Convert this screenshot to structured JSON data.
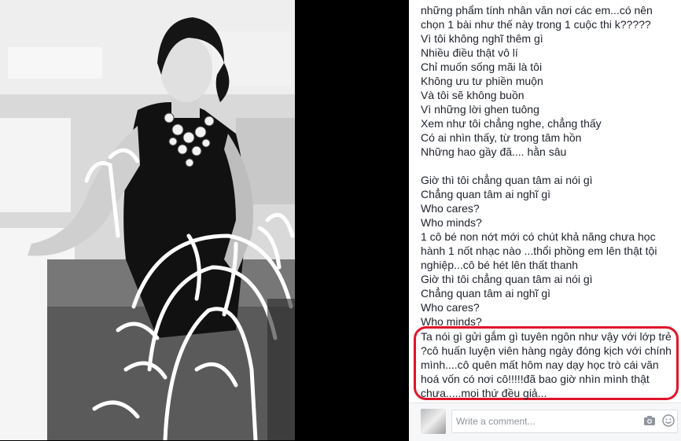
{
  "post": {
    "lines": [
      "những phẩm tính nhân văn nơi các em...có nên",
      "chọn 1 bài như thế này trong 1 cuộc thi k?????",
      "Vì tôi không nghĩ thêm gì",
      "Nhiều điều thật vô lí",
      "Chỉ muốn sống mãi là tôi",
      "Không ưu tư phiền muộn",
      "Và tôi sẽ không buồn",
      "Vì những lời ghen tuông",
      "Xem như tôi chẳng nghe, chẳng thấy",
      "Có ai nhìn thấy, từ trong tâm hồn",
      "Những hao gầy đã.... hằn sâu",
      "",
      "Giờ thì tôi chẳng quan tâm ai nói gì",
      "Chẳng quan tâm ai nghĩ gì",
      "Who cares?",
      "Who minds?",
      "1 cô bé non nớt mới có chút khả năng chưa học",
      "hành 1 nốt nhạc nào ...thổi phồng em lên thật tội",
      "nghiệp...cô bé hét lên thất thanh",
      "Giờ thì tôi chẳng quan tâm ai nói gì",
      "Chẳng quan tâm ai nghĩ gì",
      "Who cares?",
      "Who minds?"
    ],
    "highlighted_lines": [
      "Ta nói gì gửi gắm gì tuyên ngôn như vậy với lớp trẻ",
      "?cô huấn luyện viên hàng ngày đóng kịch với chính",
      "mình....cô quên mất hôm nay dạy học trò cái văn",
      "hoá vốn có nơi cô!!!!!đã bao giờ nhìn mình thật",
      "chưa.....mọi thứ đều giả..."
    ]
  },
  "comment": {
    "placeholder": "Write a comment..."
  },
  "icons": {
    "camera": "camera-icon",
    "sticker": "sticker-icon"
  },
  "colors": {
    "highlight_border": "#e0142a",
    "text": "#1d2129",
    "placeholder": "#90949c"
  }
}
